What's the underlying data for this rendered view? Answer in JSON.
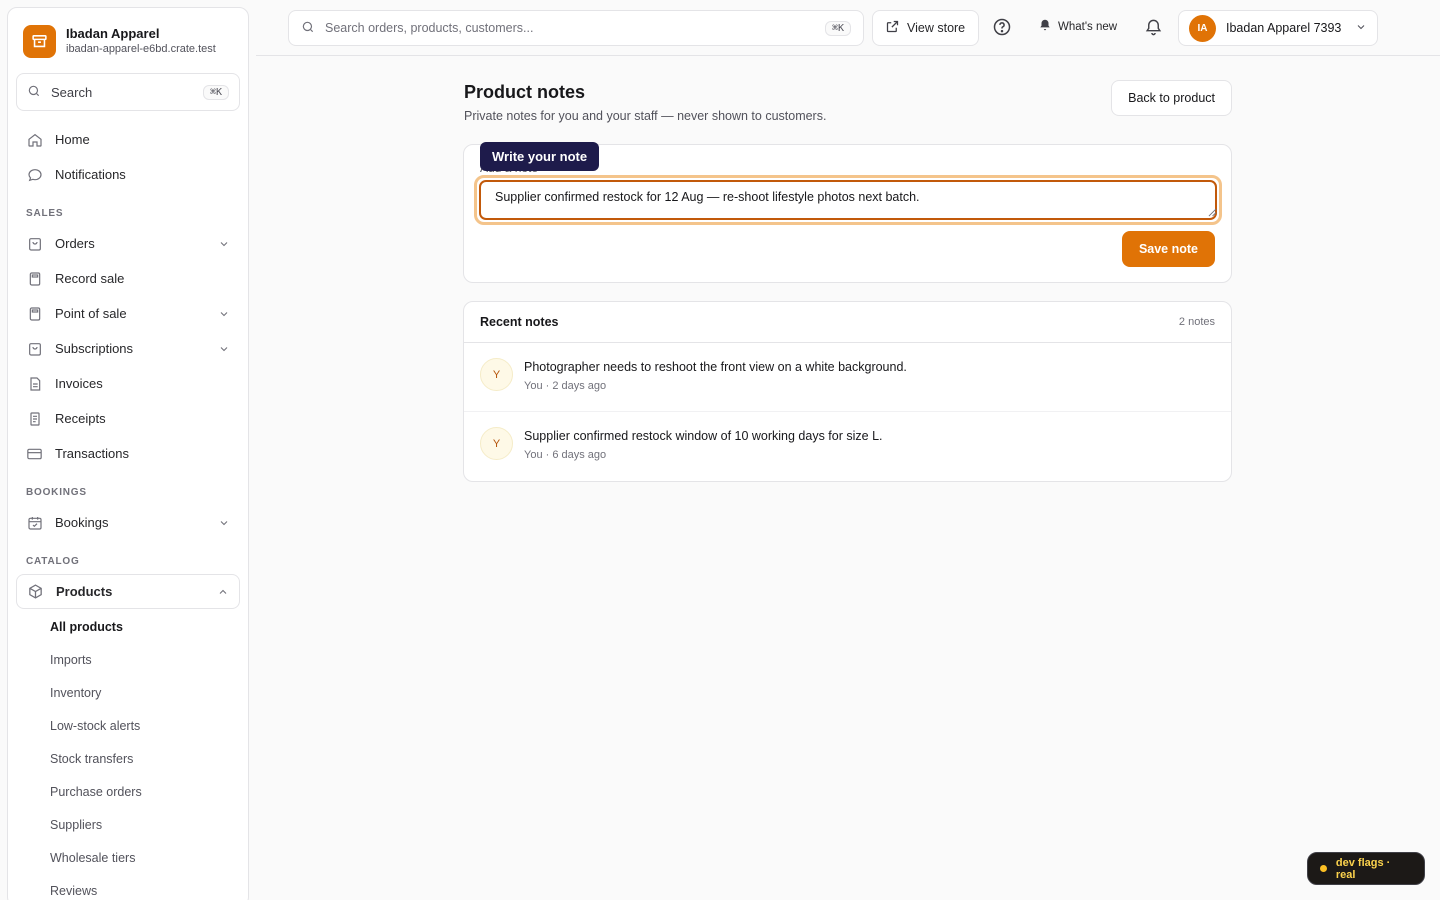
{
  "colors": {
    "accent": "#e07306",
    "tooltip_bg": "#1e1b4b",
    "border": "#e4e4e7"
  },
  "store": {
    "name": "Ibadan Apparel",
    "domain": "ibadan-apparel-e6bd.crate.test"
  },
  "sidebar": {
    "search_label": "Search",
    "search_shortcut": "⌘K",
    "top_items": [
      {
        "label": "Home",
        "icon": "home-icon"
      },
      {
        "label": "Notifications",
        "icon": "chat-bubble-icon"
      }
    ],
    "sections": {
      "sales": "SALES",
      "bookings": "BOOKINGS",
      "catalog": "CATALOG"
    },
    "sales_items": [
      {
        "label": "Orders",
        "icon": "shopping-bag-icon",
        "expandable": true
      },
      {
        "label": "Record sale",
        "icon": "calculator-icon",
        "expandable": false
      },
      {
        "label": "Point of sale",
        "icon": "calculator-icon",
        "expandable": true
      },
      {
        "label": "Subscriptions",
        "icon": "shopping-bag-icon",
        "expandable": true
      },
      {
        "label": "Invoices",
        "icon": "document-icon",
        "expandable": false
      },
      {
        "label": "Receipts",
        "icon": "receipt-icon",
        "expandable": false
      },
      {
        "label": "Transactions",
        "icon": "credit-card-icon",
        "expandable": false
      }
    ],
    "bookings_items": [
      {
        "label": "Bookings",
        "icon": "calendar-icon",
        "expandable": true
      }
    ],
    "catalog_items": [
      {
        "label": "Products",
        "icon": "box-icon",
        "expanded": true
      }
    ],
    "product_subitems": [
      "All products",
      "Imports",
      "Inventory",
      "Low-stock alerts",
      "Stock transfers",
      "Purchase orders",
      "Suppliers",
      "Wholesale tiers",
      "Reviews"
    ],
    "active_subitem": "All products"
  },
  "topbar": {
    "search_placeholder": "Search orders, products, customers...",
    "search_shortcut": "⌘K",
    "view_store": "View store",
    "whats_new": "What's new",
    "account_initials": "IA",
    "account_name": "Ibadan Apparel 7393"
  },
  "page": {
    "title": "Product notes",
    "subtitle": "Private notes for you and your staff — never shown to customers.",
    "back_button": "Back to product"
  },
  "note_form": {
    "label": "Add a note",
    "tooltip": "Write your note",
    "value": "Supplier confirmed restock for 12 Aug — re-shoot lifestyle photos next batch.",
    "save_button": "Save note"
  },
  "recent": {
    "title": "Recent notes",
    "count": "2 notes",
    "notes": [
      {
        "initial": "Y",
        "text": "Photographer needs to reshoot the front view on a white background.",
        "meta": "You · 2 days ago"
      },
      {
        "initial": "Y",
        "text": "Supplier confirmed restock window of 10 working days for size L.",
        "meta": "You · 6 days ago"
      }
    ]
  },
  "dev_flags": "dev flags · real"
}
